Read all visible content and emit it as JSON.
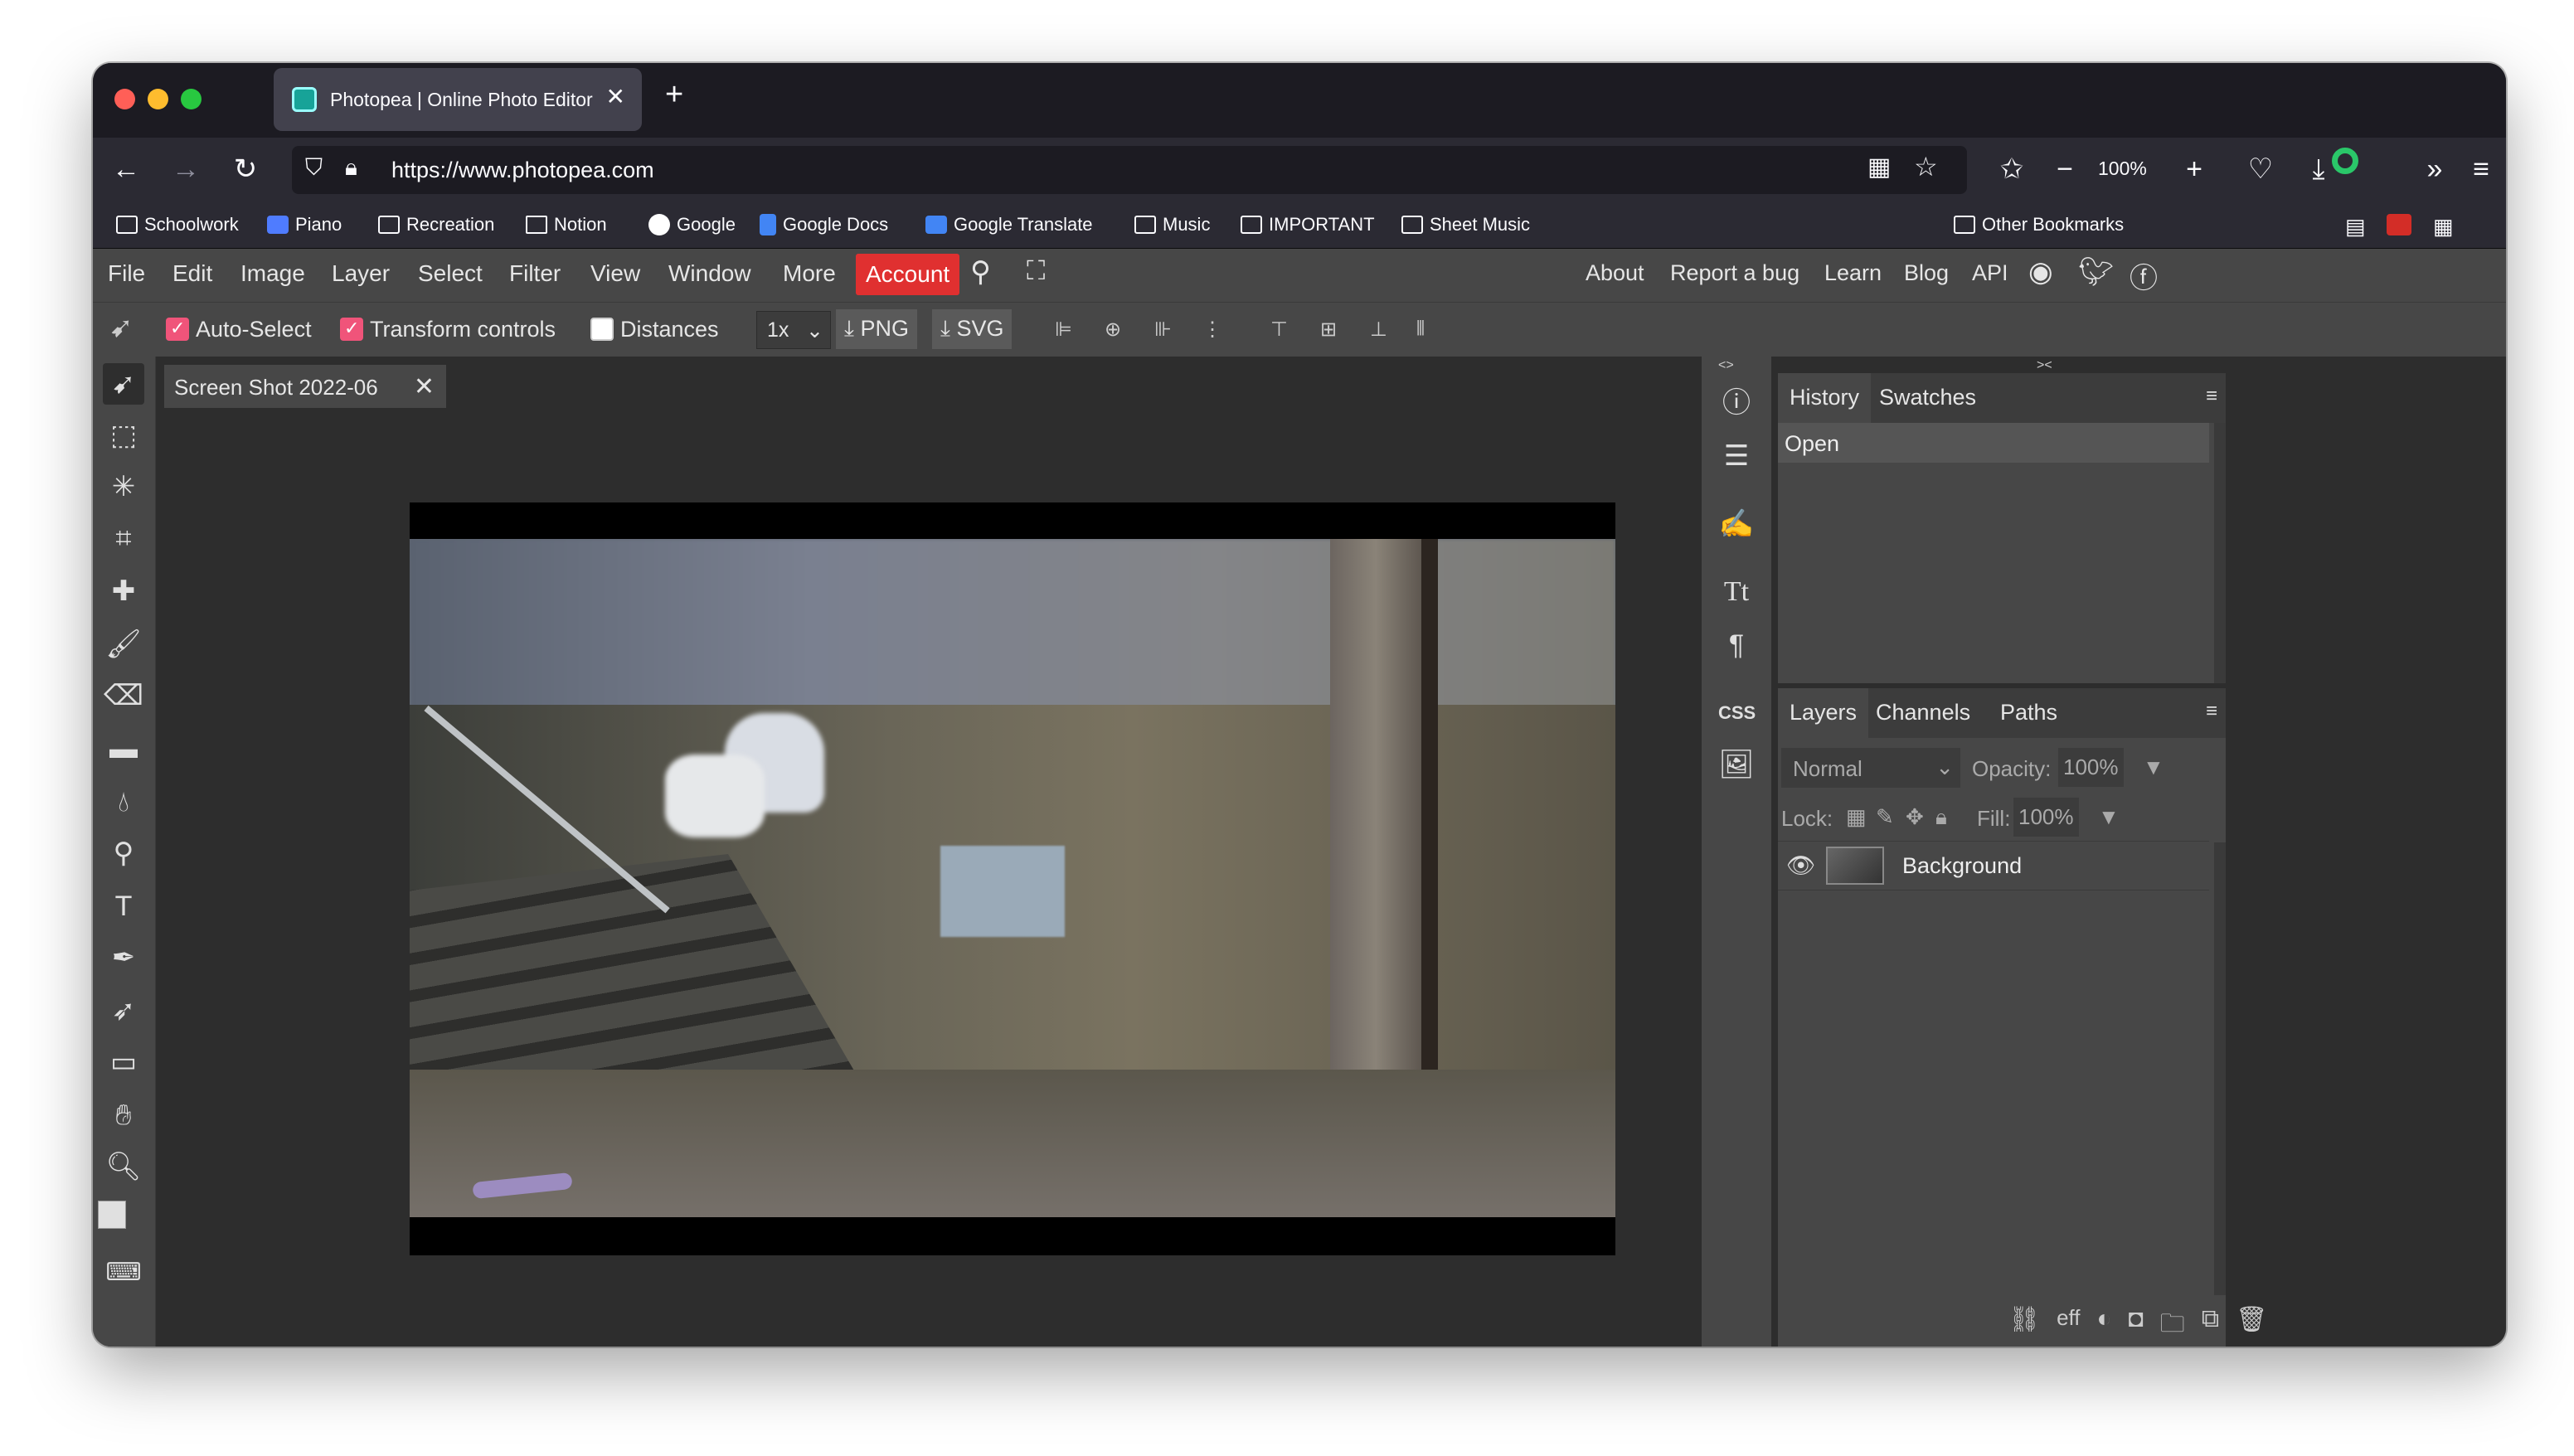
{
  "browser": {
    "tab_title": "Photopea | Online Photo Editor",
    "url": "https://www.photopea.com",
    "zoom": "100%",
    "bookmarks": [
      "Schoolwork",
      "Piano",
      "Recreation",
      "Notion",
      "Google",
      "Google Docs",
      "Google Translate",
      "Music",
      "IMPORTANT",
      "Sheet Music"
    ],
    "other_bookmarks": "Other Bookmarks"
  },
  "menu": {
    "items": [
      "File",
      "Edit",
      "Image",
      "Layer",
      "Select",
      "Filter",
      "View",
      "Window",
      "More"
    ],
    "account": "Account",
    "right": [
      "About",
      "Report a bug",
      "Learn",
      "Blog",
      "API"
    ]
  },
  "options": {
    "auto_select": "Auto-Select",
    "transform_controls": "Transform controls",
    "distances": "Distances",
    "scale": "1x",
    "png": "PNG",
    "svg": "SVG"
  },
  "document": {
    "tab_name": "Screen Shot 2022-06"
  },
  "panels": {
    "history_tab": "History",
    "swatches_tab": "Swatches",
    "history_items": [
      "Open"
    ],
    "layers_tab": "Layers",
    "channels_tab": "Channels",
    "paths_tab": "Paths",
    "blend_mode": "Normal",
    "opacity_label": "Opacity:",
    "opacity": "100%",
    "lock_label": "Lock:",
    "fill_label": "Fill:",
    "fill": "100%",
    "layers": [
      "Background"
    ],
    "css_label": "CSS",
    "footer_fx": "eff"
  },
  "colors": {
    "accent": "#e03030",
    "checkbox": "#f0547a",
    "panel_bg": "#474747",
    "workspace": "#2d2d2d"
  }
}
